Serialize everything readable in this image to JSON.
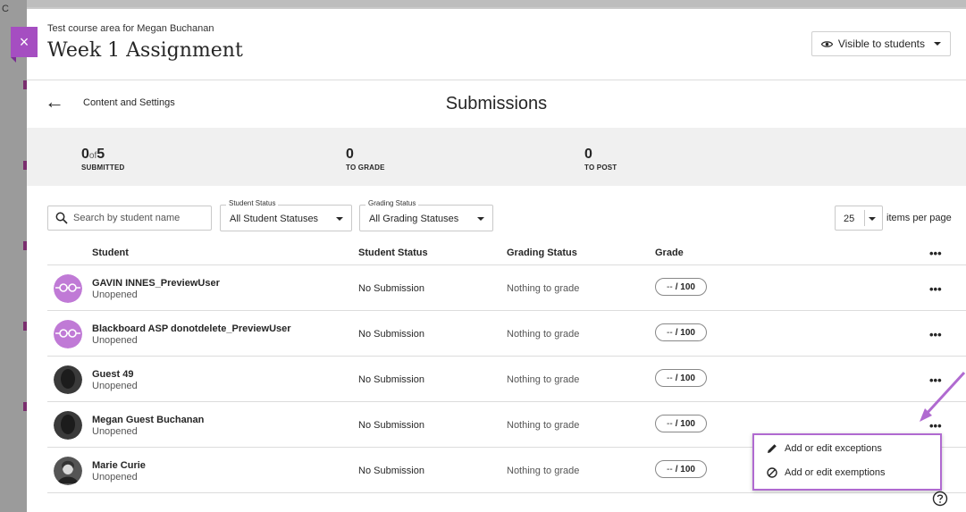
{
  "left_strip": {
    "partial_char": "C"
  },
  "header": {
    "course_area": "Test course area for Megan Buchanan",
    "title": "Week 1 Assignment",
    "visibility": "Visible to students",
    "close_label": "×"
  },
  "subheader": {
    "back_label": "Content and Settings",
    "section_title": "Submissions"
  },
  "stats": {
    "submitted": {
      "num": "0",
      "of": "of",
      "total": "5",
      "label": "SUBMITTED"
    },
    "to_grade": {
      "num": "0",
      "label": "TO GRADE"
    },
    "to_post": {
      "num": "0",
      "label": "TO POST"
    }
  },
  "filters": {
    "search_placeholder": "Search by student name",
    "student_status": {
      "legend": "Student Status",
      "value": "All Student Statuses"
    },
    "grading_status": {
      "legend": "Grading Status",
      "value": "All Grading Statuses"
    },
    "per_page": {
      "value": "25",
      "label": "items per page"
    }
  },
  "columns": {
    "student": "Student",
    "student_status": "Student Status",
    "grading_status": "Grading Status",
    "grade": "Grade",
    "more": "•••"
  },
  "rows": [
    {
      "name": "GAVIN INNES_PreviewUser",
      "sub": "Unopened",
      "status": "No Submission",
      "grading": "Nothing to grade",
      "grade_value": "--",
      "grade_max": "/ 100",
      "more": "•••",
      "avatar": "preview-user-avatar"
    },
    {
      "name": "Blackboard ASP donotdelete_PreviewUser",
      "sub": "Unopened",
      "status": "No Submission",
      "grading": "Nothing to grade",
      "grade_value": "--",
      "grade_max": "/ 100",
      "more": "•••",
      "avatar": "preview-user-avatar"
    },
    {
      "name": "Guest 49",
      "sub": "Unopened",
      "status": "No Submission",
      "grading": "Nothing to grade",
      "grade_value": "--",
      "grade_max": "/ 100",
      "more": "•••",
      "avatar": "default-user-avatar"
    },
    {
      "name": "Megan Guest Buchanan",
      "sub": "Unopened",
      "status": "No Submission",
      "grading": "Nothing to grade",
      "grade_value": "--",
      "grade_max": "/ 100",
      "more": "•••",
      "avatar": "default-user-avatar"
    },
    {
      "name": "Marie Curie",
      "sub": "Unopened",
      "status": "No Submission",
      "grading": "Nothing to grade",
      "grade_value": "--",
      "grade_max": "/ 100",
      "more": "•••",
      "avatar": "photo-avatar"
    }
  ],
  "context_menu": {
    "items": [
      {
        "label": "Add or edit exceptions",
        "icon": "pencil-icon"
      },
      {
        "label": "Add or edit exemptions",
        "icon": "prohibited-icon"
      }
    ]
  },
  "colors": {
    "accent_purple": "#a54ec1",
    "annotation_purple": "#b06ad0",
    "stats_bg": "#f0f0f0"
  }
}
